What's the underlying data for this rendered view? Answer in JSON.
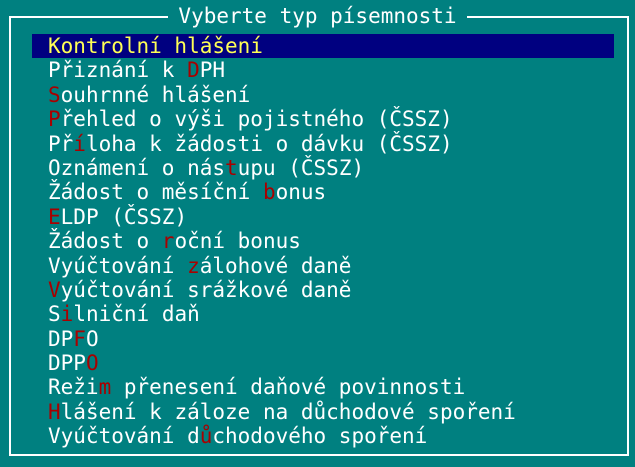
{
  "dialog": {
    "title": "Vyberte typ písemnosti"
  },
  "colors": {
    "background": "#008080",
    "text": "#ffffff",
    "hotkey": "#a80000",
    "selection_bg": "#000080",
    "selection_text": "#ffff55"
  },
  "items": [
    {
      "pre": "",
      "hot": "",
      "post": "Kontrolní hlášení",
      "selected": true
    },
    {
      "pre": "Přiznání k ",
      "hot": "D",
      "post": "PH",
      "selected": false
    },
    {
      "pre": "",
      "hot": "S",
      "post": "ouhrnné hlášení",
      "selected": false
    },
    {
      "pre": "",
      "hot": "P",
      "post": "řehled o výši pojistného (ČSSZ)",
      "selected": false
    },
    {
      "pre": "Př",
      "hot": "í",
      "post": "loha k žádosti o dávku (ČSSZ)",
      "selected": false
    },
    {
      "pre": "Oznámení o nás",
      "hot": "t",
      "post": "upu (ČSSZ)",
      "selected": false
    },
    {
      "pre": "Žádost o měsíční ",
      "hot": "b",
      "post": "onus",
      "selected": false
    },
    {
      "pre": "",
      "hot": "E",
      "post": "LDP (ČSSZ)",
      "selected": false
    },
    {
      "pre": "Žádost o ",
      "hot": "r",
      "post": "oční bonus",
      "selected": false
    },
    {
      "pre": "Vyúčtování ",
      "hot": "z",
      "post": "álohové daně",
      "selected": false
    },
    {
      "pre": "",
      "hot": "V",
      "post": "yúčtování srážkové daně",
      "selected": false
    },
    {
      "pre": "S",
      "hot": "i",
      "post": "lniční daň",
      "selected": false
    },
    {
      "pre": "DP",
      "hot": "F",
      "post": "O",
      "selected": false
    },
    {
      "pre": "DPP",
      "hot": "O",
      "post": "",
      "selected": false
    },
    {
      "pre": "Reži",
      "hot": "m",
      "post": " přenesení daňové povinnosti",
      "selected": false
    },
    {
      "pre": "",
      "hot": "H",
      "post": "lášení k záloze na důchodové spoření",
      "selected": false
    },
    {
      "pre": "Vyúčtování d",
      "hot": "ů",
      "post": "chodového spoření",
      "selected": false
    }
  ]
}
